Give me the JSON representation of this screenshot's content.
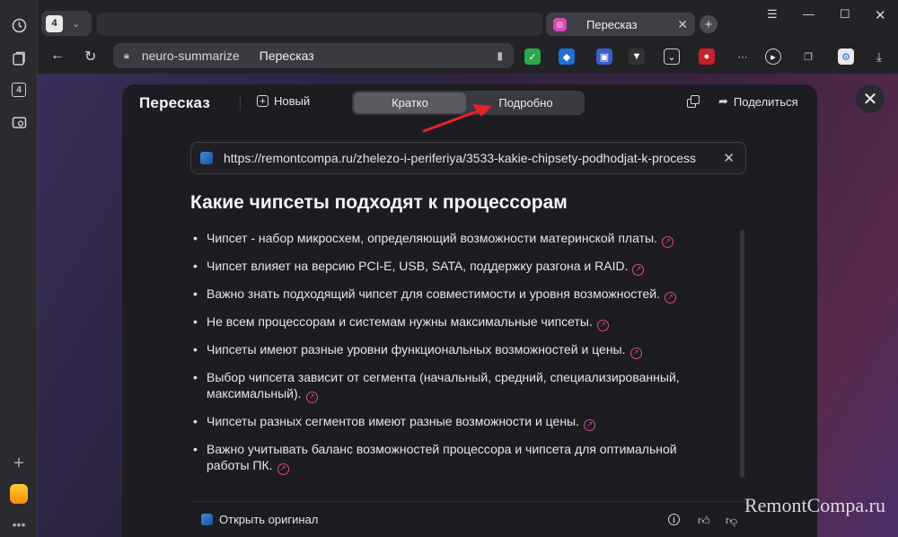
{
  "browser": {
    "tab_count": "4",
    "active_tab_title": "Пересказ",
    "address_host": "neuro-summarize",
    "address_title": "Пересказ",
    "window_controls": [
      "minimize-icon",
      "maximize-icon",
      "close-icon"
    ]
  },
  "sidebar": {
    "items": [
      "history-icon",
      "bookmarks-icon",
      "tabs-badge-icon",
      "screenshot-icon"
    ],
    "tabs_badge": "4",
    "bottom": [
      "add-icon",
      "mail-icon",
      "more-icon"
    ]
  },
  "panel": {
    "brand": "Пересказ",
    "new_label": "Новый",
    "mode_short": "Кратко",
    "mode_detailed": "Подробно",
    "share_label": "Поделиться",
    "source_url": "https://remontcompa.ru/zhelezo-i-periferiya/3533-kakie-chipsety-podhodjat-k-process",
    "heading": "Какие чипсеты подходят к процессорам",
    "bullets": [
      "Чипсет - набор микросхем, определяющий возможности материнской платы.",
      "Чипсет влияет на версию PCI-E, USB, SATA, поддержку разгона и RAID.",
      "Важно знать подходящий чипсет для совместимости и уровня возможностей.",
      "Не всем процессорам и системам нужны максимальные чипсеты.",
      "Чипсеты имеют разные уровни функциональных возможностей и цены.",
      "Выбор чипсета зависит от сегмента (начальный, средний, специализированный, максимальный).",
      "Чипсеты разных сегментов имеют разные возможности и цены.",
      "Важно учитывать баланс возможностей процессора и чипсета для оптимальной работы ПК."
    ],
    "open_original": "Открыть оригинал"
  },
  "watermark": "RemontCompa.ru",
  "colors": {
    "accent_link": "#d84a9a",
    "panel_bg": "#1c1c21",
    "arrow_red": "#e8202a"
  }
}
